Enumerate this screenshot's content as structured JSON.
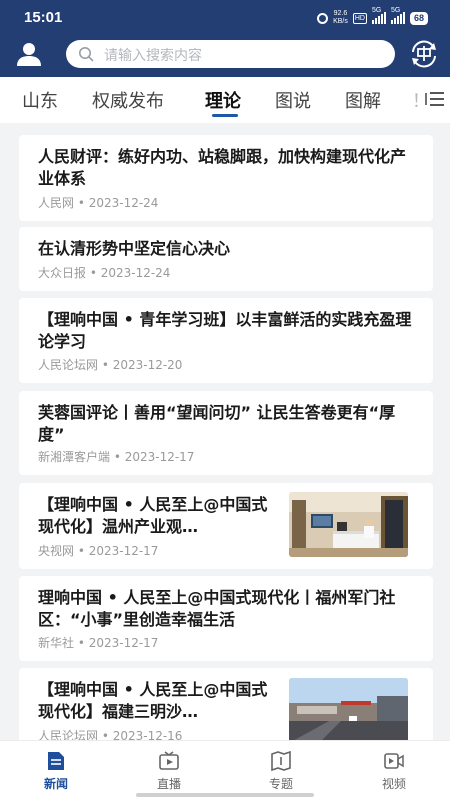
{
  "status": {
    "time": "15:01",
    "speed_value": "92.6",
    "speed_unit": "KB/s",
    "hd": "HD",
    "net1": "5G",
    "net2": "5G",
    "battery": "68"
  },
  "search": {
    "placeholder": "请输入搜索内容"
  },
  "tabs": [
    {
      "label": "山东",
      "active": false
    },
    {
      "label": "权威发布",
      "active": false
    },
    {
      "label": "理论",
      "active": true
    },
    {
      "label": "图说",
      "active": false
    },
    {
      "label": "图解",
      "active": false
    },
    {
      "label": "！",
      "active": false
    }
  ],
  "articles": [
    {
      "title": "人民财评：练好内功、站稳脚跟，加快构建现代化产业体系",
      "source": "人民网",
      "date": "2023-12-24",
      "meta": "人民网 • 2023-12-24"
    },
    {
      "title": "在认清形势中坚定信心决心",
      "source": "大众日报",
      "date": "2023-12-24",
      "meta": "大众日报 • 2023-12-24"
    },
    {
      "title": "【理响中国 • 青年学习班】以丰富鲜活的实践充盈理论学习",
      "source": "人民论坛网",
      "date": "2023-12-20",
      "meta": "人民论坛网 • 2023-12-20"
    },
    {
      "title": "芙蓉国评论丨善用“望闻问切” 让民生答卷更有“厚度”",
      "source": "新湘潭客户端",
      "date": "2023-12-17",
      "meta": "新湘潭客户端 • 2023-12-17"
    },
    {
      "title": "【理响中国 • 人民至上@中国式现代化】温州产业观…",
      "source": "央视网",
      "date": "2023-12-17",
      "meta": "央视网 • 2023-12-17",
      "has_thumb": true
    },
    {
      "title": "理响中国 • 人民至上@中国式现代化丨福州军门社区：“小事”里创造幸福生活",
      "source": "新华社",
      "date": "2023-12-17",
      "meta": "新华社 • 2023-12-17"
    },
    {
      "title": "【理响中国 • 人民至上@中国式现代化】福建三明沙…",
      "source": "人民论坛网",
      "date": "2023-12-16",
      "meta": "人民论坛网 • 2023-12-16",
      "has_thumb": true
    }
  ],
  "bottom_nav": [
    {
      "label": "新闻",
      "icon": "news-icon",
      "active": true
    },
    {
      "label": "直播",
      "icon": "tv-icon",
      "active": false
    },
    {
      "label": "专题",
      "icon": "book-icon",
      "active": false
    },
    {
      "label": "视频",
      "icon": "video-icon",
      "active": false
    }
  ],
  "colors": {
    "header": "#233e73",
    "accent": "#1f57a8",
    "page_bg": "#f2f3f5"
  }
}
